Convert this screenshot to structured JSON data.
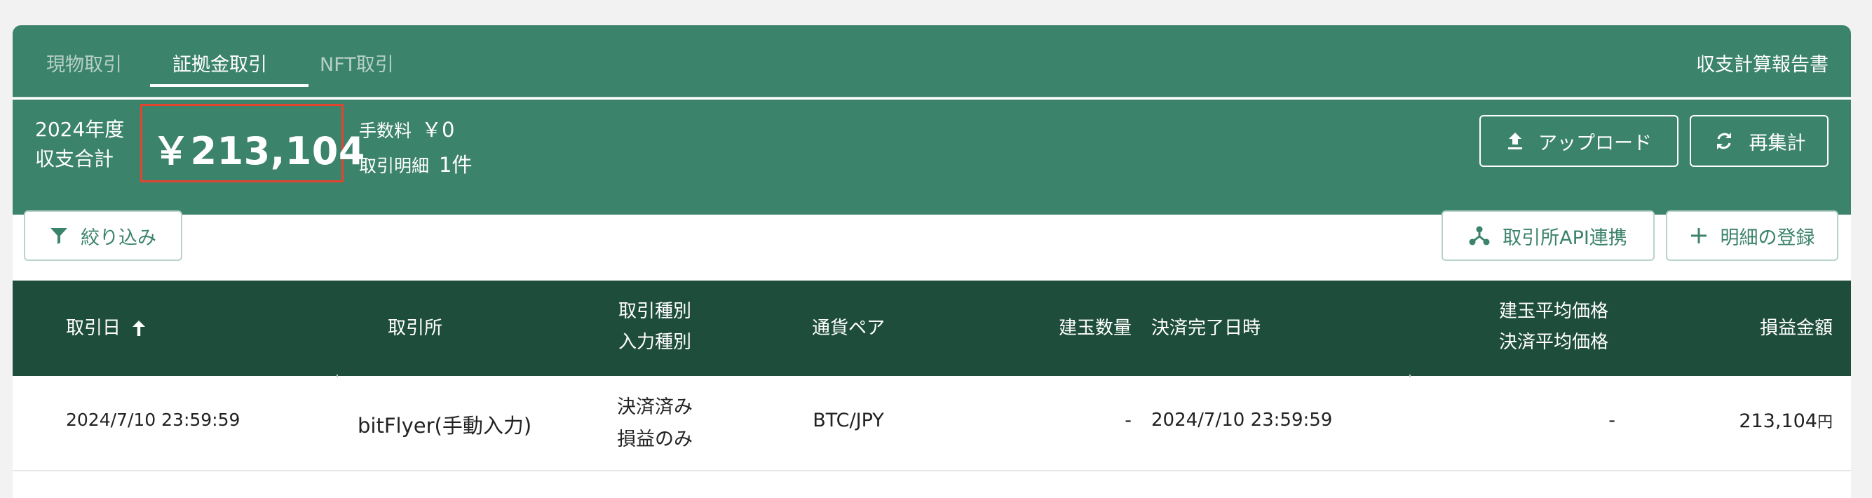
{
  "tabs": [
    {
      "label": "現物取引",
      "active": false
    },
    {
      "label": "証拠金取引",
      "active": true
    },
    {
      "label": "NFT取引",
      "active": false
    }
  ],
  "report_link": "収支計算報告書",
  "summary": {
    "year_label_line1": "2024年度",
    "year_label_line2": "収支合計",
    "total": "￥213,104",
    "fee_label": "手数料",
    "fee_value": "￥0",
    "count_label": "取引明細",
    "count_value": "1件",
    "highlight_color": "#e2452f"
  },
  "buttons": {
    "upload": {
      "label": "アップロード",
      "icon": "upload-icon"
    },
    "recalc": {
      "label": "再集計",
      "icon": "refresh-icon"
    },
    "filter": {
      "label": "絞り込み",
      "icon": "filter-icon"
    },
    "api": {
      "label": "取引所API連携",
      "icon": "network-icon"
    },
    "add": {
      "label": "明細の登録",
      "icon": "plus-icon"
    }
  },
  "table": {
    "columns": {
      "date": "取引日",
      "exchange": "取引所",
      "type_line1": "取引種別",
      "type_line2": "入力種別",
      "pair": "通貨ペア",
      "qty": "建玉数量",
      "settle": "決済完了日時",
      "avg_line1": "建玉平均価格",
      "avg_line2": "決済平均価格",
      "pnl": "損益金額"
    },
    "sort": "ascending",
    "rows": [
      {
        "date": "2024/7/10 23:59:59",
        "exchange": "bitFlyer(手動入力)",
        "type_line1": "決済済み",
        "type_line2": "損益のみ",
        "pair": "BTC/JPY",
        "qty": "-",
        "settle": "2024/7/10 23:59:59",
        "avg": "-",
        "pnl": "213,104",
        "pnl_unit": "円"
      }
    ]
  },
  "colors": {
    "brand_green": "#3c836b",
    "header_dark_green": "#1e4d3c"
  }
}
